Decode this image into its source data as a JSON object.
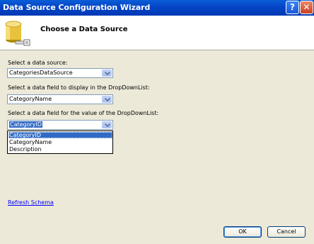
{
  "window": {
    "title": "Data Source Configuration Wizard",
    "help_glyph": "?",
    "close_glyph": "✕"
  },
  "header": {
    "heading": "Choose a Data Source",
    "icon": "database-icon"
  },
  "form": {
    "datasource_label": "Select a data source:",
    "datasource_value": "CategoriesDataSource",
    "display_label": "Select a data field to display in the DropDownList:",
    "display_value": "CategoryName",
    "value_label": "Select a data field for the value of the DropDownList:",
    "value_value": "CategoryID",
    "value_options": [
      "CategoryID",
      "CategoryName",
      "Description"
    ]
  },
  "links": {
    "refresh": "Refresh Schema"
  },
  "buttons": {
    "ok": "OK",
    "cancel": "Cancel"
  },
  "colors": {
    "selection": "#316ac5",
    "titlebar": "#0546c7",
    "link": "#0000ff"
  }
}
